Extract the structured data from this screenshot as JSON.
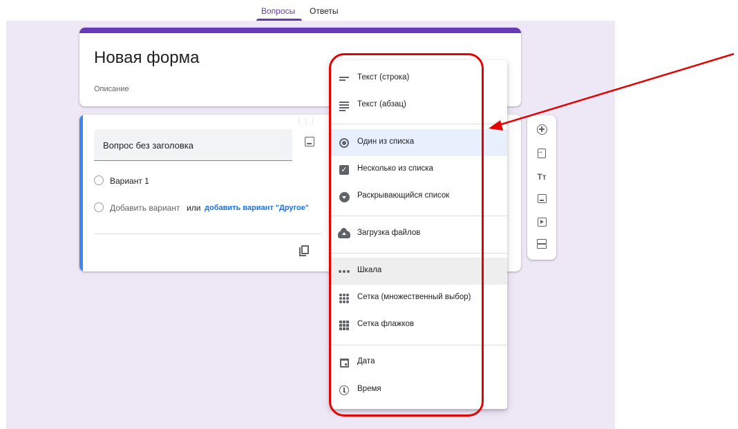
{
  "tabs": {
    "questions": "Вопросы",
    "answers": "Ответы"
  },
  "form": {
    "title": "Новая форма",
    "description": "Описание"
  },
  "question": {
    "title": "Вопрос без заголовка",
    "option1": "Вариант 1",
    "add_option": "Добавить вариант",
    "or": "или",
    "add_other": "добавить вариант \"Другое\""
  },
  "menu": {
    "items": [
      {
        "label": "Текст (строка)",
        "icon": "short-text-icon"
      },
      {
        "label": "Текст (абзац)",
        "icon": "paragraph-icon"
      },
      {
        "label": "Один из списка",
        "icon": "radio-icon",
        "selected": true
      },
      {
        "label": "Несколько из списка",
        "icon": "checkbox-icon"
      },
      {
        "label": "Раскрывающийся список",
        "icon": "dropdown-icon"
      },
      {
        "label": "Загрузка файлов",
        "icon": "cloud-upload-icon"
      },
      {
        "label": "Шкала",
        "icon": "linear-scale-icon",
        "hovered": true
      },
      {
        "label": "Сетка (множественный выбор)",
        "icon": "radio-grid-icon"
      },
      {
        "label": "Сетка флажков",
        "icon": "checkbox-grid-icon"
      },
      {
        "label": "Дата",
        "icon": "calendar-icon"
      },
      {
        "label": "Время",
        "icon": "clock-icon"
      }
    ]
  },
  "toolbar": {
    "text_icon_label": "Tт"
  },
  "colors": {
    "accent": "#673ab7",
    "annotation": "#e60000",
    "canvas": "#ede7f6",
    "link": "#1a73e8"
  }
}
